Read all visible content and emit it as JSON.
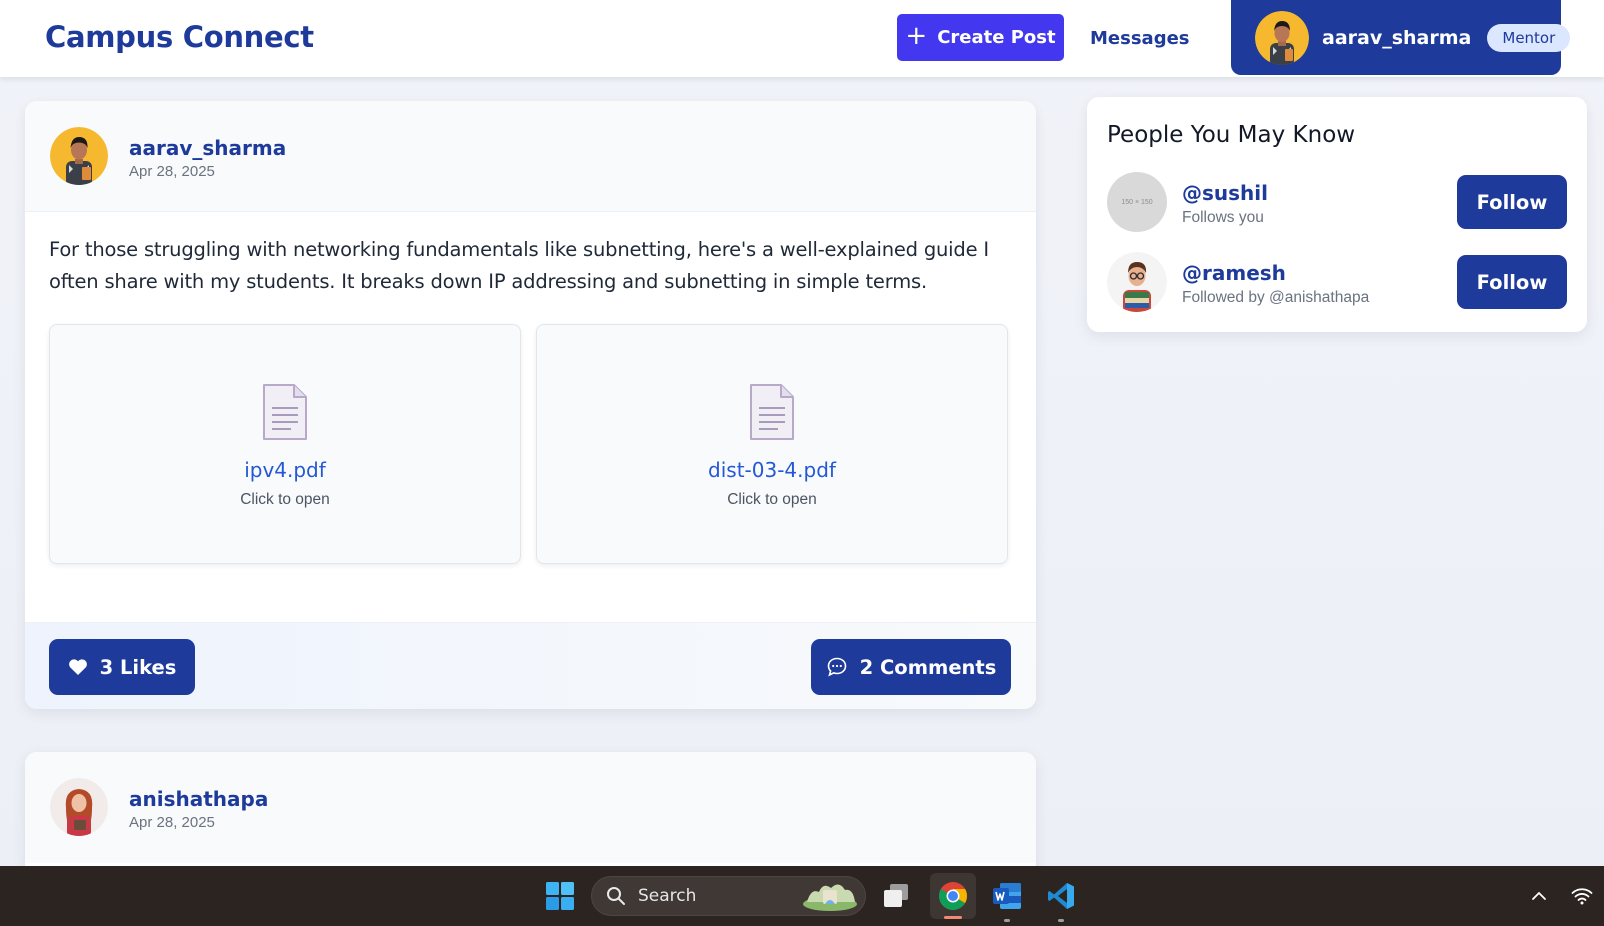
{
  "header": {
    "brand": "Campus Connect",
    "create_post_label": "Create Post",
    "messages_label": "Messages",
    "current_user": "aarav_sharma",
    "role_badge": "Mentor"
  },
  "post": {
    "author": "aarav_sharma",
    "date": "Apr 28, 2025",
    "body": "For those struggling with networking fundamentals like subnetting, here's a well-explained guide I often share with my students. It breaks down IP addressing and subnetting in simple terms.",
    "attachments": [
      {
        "name": "ipv4.pdf",
        "hint": "Click to open"
      },
      {
        "name": "dist-03-4.pdf",
        "hint": "Click to open"
      }
    ],
    "likes_label": "3 Likes",
    "comments_label": "2 Comments"
  },
  "next_post": {
    "author": "anishathapa",
    "date": "Apr 28, 2025"
  },
  "sidebar": {
    "title": "People You May Know",
    "suggestions": [
      {
        "handle": "@sushil",
        "subtitle": "Follows you",
        "follow_label": "Follow",
        "avatar_text": "150 × 150"
      },
      {
        "handle": "@ramesh",
        "subtitle": "Followed by @anishathapa",
        "follow_label": "Follow"
      }
    ]
  },
  "taskbar": {
    "search_label": "Search",
    "icons": [
      "windows-start-icon",
      "search-icon",
      "task-view-icon",
      "chrome-icon",
      "word-icon",
      "vscode-icon",
      "chevron-up-icon",
      "wifi-icon"
    ]
  },
  "colors": {
    "brand_blue": "#1e3a9a",
    "create_purple": "#4338ef",
    "link_blue": "#2458d6",
    "badge_bg": "#dbe6ff",
    "taskbar_bg": "#2b2421"
  }
}
